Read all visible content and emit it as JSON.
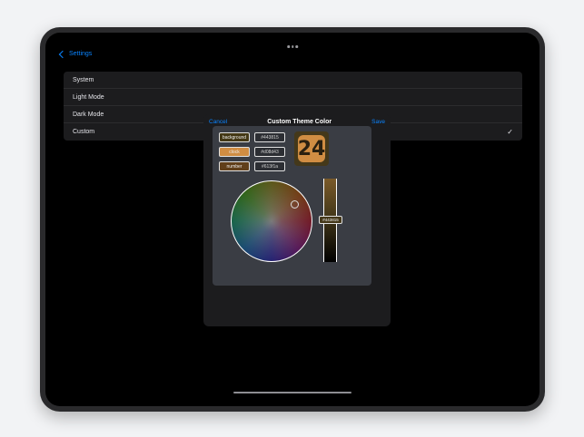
{
  "nav": {
    "back_label": "Settings"
  },
  "theme_list": {
    "items": [
      {
        "label": "System"
      },
      {
        "label": "Light Mode"
      },
      {
        "label": "Dark Mode"
      },
      {
        "label": "Custom",
        "checked": true
      }
    ]
  },
  "sheet": {
    "cancel_label": "Cancel",
    "title": "Custom Theme Color",
    "save_label": "Save"
  },
  "color_rows": [
    {
      "name": "background",
      "hex": "#443815",
      "swatch": "#443815"
    },
    {
      "name": "clock",
      "hex": "#d08d43",
      "swatch": "#d08d43"
    },
    {
      "name": "number",
      "hex": "#613f1a",
      "swatch": "#613f1a"
    }
  ],
  "preview": {
    "text": "24",
    "bg": "#44381a",
    "fg": "#d08d43"
  },
  "slider": {
    "value_label": "#443815"
  },
  "colors": {
    "accent": "#0a84ff",
    "background": "#000000"
  }
}
